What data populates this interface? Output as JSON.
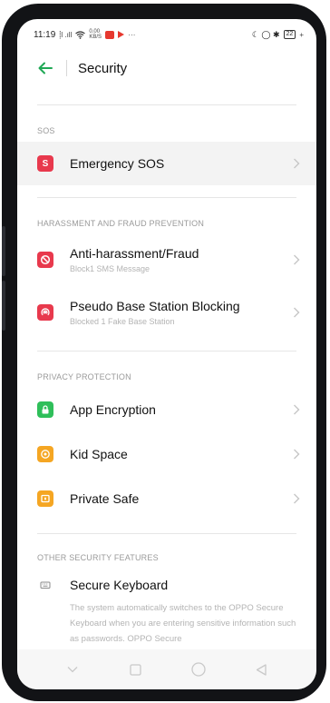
{
  "status_bar": {
    "time": "11:19",
    "signal_text": "⸽l .ıll",
    "net_speed": "0.00 KB/S",
    "more": "···",
    "right_text": "☾ ◯ ✱",
    "battery": "22"
  },
  "header": {
    "title": "Security"
  },
  "sections": {
    "sos": {
      "label": "SOS",
      "items": [
        {
          "title": "Emergency SOS",
          "icon": "sos-icon",
          "icon_letter": "S",
          "color": "#e8394d"
        }
      ]
    },
    "harassment": {
      "label": "HARASSMENT AND FRAUD PREVENTION",
      "items": [
        {
          "title": "Anti-harassment/Fraud",
          "subtitle": "Block1 SMS Message",
          "icon": "block-icon",
          "color": "#e8394d"
        },
        {
          "title": "Pseudo Base Station Blocking",
          "subtitle": "Blocked 1 Fake Base Station",
          "icon": "antenna-icon",
          "color": "#e8394d"
        }
      ]
    },
    "privacy": {
      "label": "PRIVACY PROTECTION",
      "items": [
        {
          "title": "App Encryption",
          "icon": "lock-icon",
          "color": "#2fbf5a"
        },
        {
          "title": "Kid Space",
          "icon": "kid-icon",
          "color": "#f5a623"
        },
        {
          "title": "Private Safe",
          "icon": "safe-icon",
          "color": "#f5a623"
        }
      ]
    },
    "other": {
      "label": "OTHER SECURITY FEATURES",
      "items": [
        {
          "title": "Secure Keyboard",
          "icon": "keyboard-icon",
          "description": "The system automatically switches to the OPPO Secure Keyboard when you are entering sensitive information such as passwords. OPPO Secure"
        }
      ]
    }
  },
  "nav_bar": {
    "buttons": [
      "chevron-down-icon",
      "recents-icon",
      "home-icon",
      "back-nav-icon"
    ]
  }
}
